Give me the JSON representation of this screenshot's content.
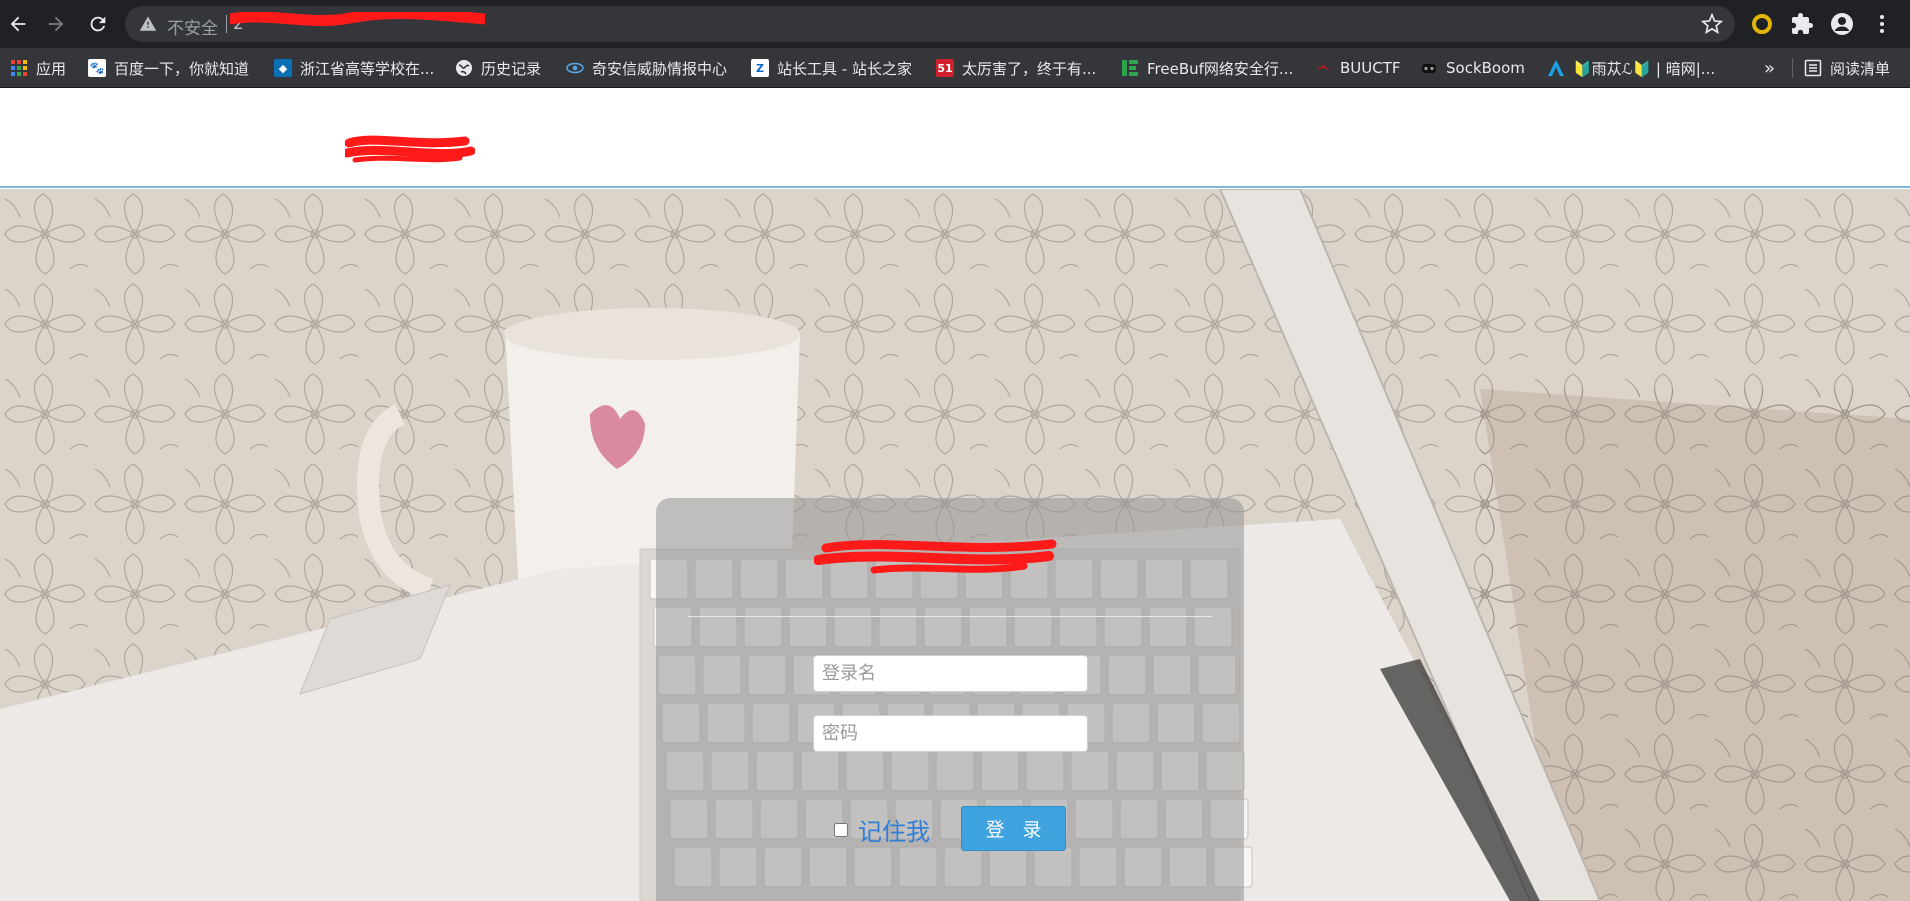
{
  "browser": {
    "security_label": "不安全",
    "url_partial": "2",
    "colors": {
      "toolbar": "#202124",
      "omnibox": "#35363a",
      "redaction": "#ff1a1a"
    }
  },
  "bookmarks": [
    {
      "label": "应用",
      "icon": "apps-grid-icon"
    },
    {
      "label": "百度一下，你就知道",
      "icon": "baidu-icon"
    },
    {
      "label": "浙江省高等学校在...",
      "icon": "zj-school-icon"
    },
    {
      "label": "历史记录",
      "icon": "globe-icon"
    },
    {
      "label": "奇安信威胁情报中心",
      "icon": "qianxin-eye-icon"
    },
    {
      "label": "站长工具 - 站长之家",
      "icon": "chinaz-icon"
    },
    {
      "label": "太厉害了，终于有...",
      "icon": "51-icon"
    },
    {
      "label": "FreeBuf网络安全行...",
      "icon": "freebuf-icon"
    },
    {
      "label": "BUUCTF",
      "icon": "buuctf-icon"
    },
    {
      "label": "SockBoom",
      "icon": "sockboom-icon"
    },
    {
      "label": "🔰雨苁ℒ🔰 | 暗网|...",
      "icon": "yucong-icon"
    }
  ],
  "bookmarks_overflow": "»",
  "reading_list": "阅读清单",
  "login": {
    "username_placeholder": "登录名",
    "password_placeholder": "密码",
    "remember_label": "记住我",
    "submit_label": "登 录",
    "colors": {
      "button": "#3fa3df",
      "remember_text": "#2f7fd6"
    }
  }
}
